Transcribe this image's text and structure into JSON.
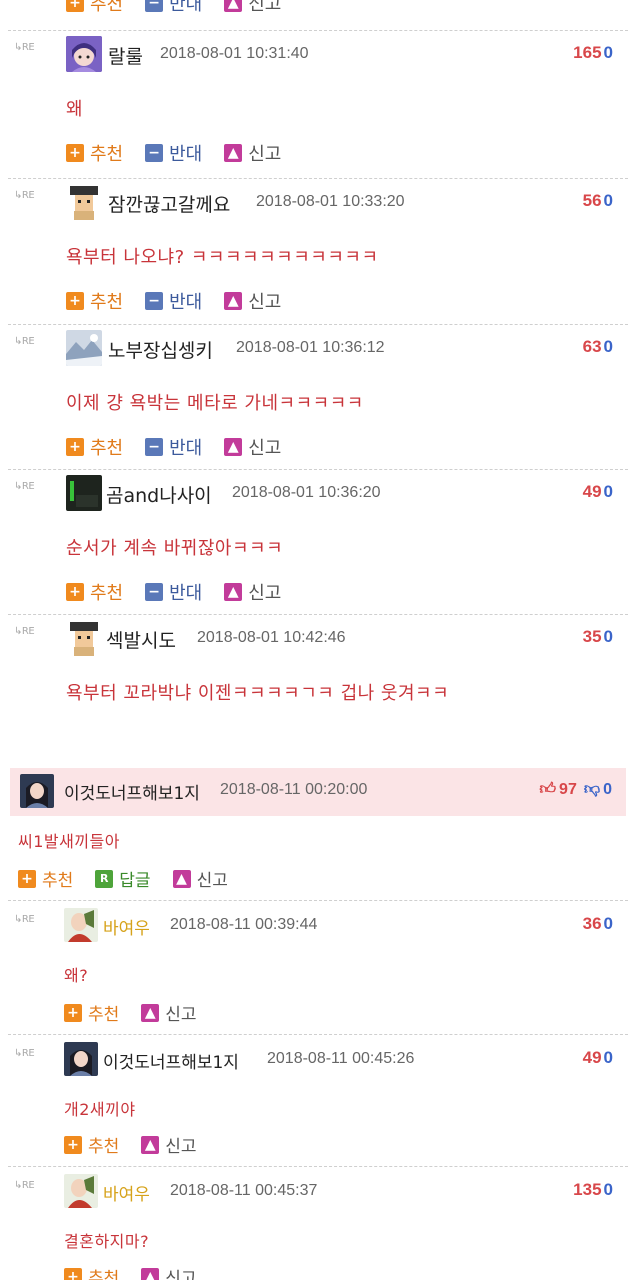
{
  "actions": {
    "recommend": "추천",
    "oppose": "반대",
    "report": "신고",
    "reply": "답글"
  },
  "re_label": "RE",
  "best_comment": {
    "author": "이것도너프해보1지",
    "date": "2018-08-11 00:20:00",
    "upvotes": "97",
    "downvotes": "0",
    "text": "씨1발새끼들아"
  },
  "comments": [
    {
      "author": "랄룰",
      "date": "2018-08-01 10:31:40",
      "score": "165",
      "zero": "0",
      "text": "왜"
    },
    {
      "author": "잠깐끊고갈께요",
      "date": "2018-08-01 10:33:20",
      "score": "56",
      "zero": "0",
      "text": "욕부터 나오냐? ㅋㅋㅋㅋㅋㅋㅋㅋㅋㅋㅋ"
    },
    {
      "author": "노부장십셍키",
      "date": "2018-08-01 10:36:12",
      "score": "63",
      "zero": "0",
      "text": "이제 걍 욕박는 메타로 가네ㅋㅋㅋㅋㅋ"
    },
    {
      "author": "곰and나사이",
      "date": "2018-08-01 10:36:20",
      "score": "49",
      "zero": "0",
      "text": "순서가 계속 바뀌잖아ㅋㅋㅋ"
    },
    {
      "author": "섹발시도",
      "date": "2018-08-01 10:42:46",
      "score": "35",
      "zero": "0",
      "text": "욕부터 꼬라박냐 이젠ㅋㅋㅋㅋㄱㅋ 겁나 웃겨ㅋㅋ"
    }
  ],
  "replies": [
    {
      "author": "바여우",
      "date": "2018-08-11 00:39:44",
      "score": "36",
      "zero": "0",
      "text": "왜?"
    },
    {
      "author": "이것도너프해보1지",
      "date": "2018-08-11 00:45:26",
      "score": "49",
      "zero": "0",
      "text": "개2새끼야"
    },
    {
      "author": "바여우",
      "date": "2018-08-11 00:45:37",
      "score": "135",
      "zero": "0",
      "text": "결혼하지마?"
    }
  ]
}
